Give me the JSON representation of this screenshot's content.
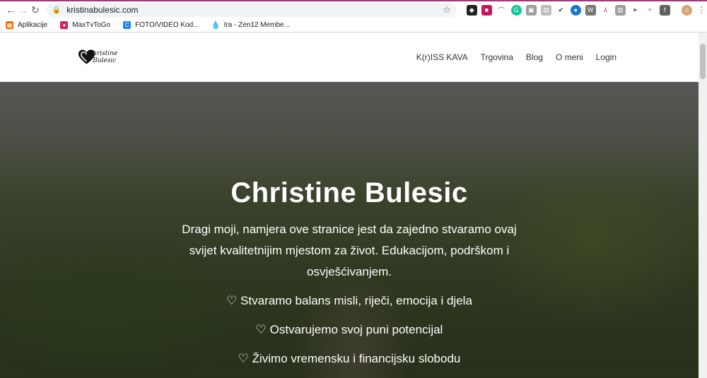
{
  "browser": {
    "url": "kristinabulesic.com",
    "bookmarks": [
      {
        "label": "Aplikacije",
        "icon": "apps-grid-icon",
        "color": "#e8710a"
      },
      {
        "label": "MaxTvToGo",
        "icon": "maxtv-icon",
        "color": "#d81b60"
      },
      {
        "label": "FOTO/VIDEO Kod...",
        "icon": "foto-icon",
        "color": "#1e88e5"
      },
      {
        "label": "Ira - Zen12 Membe...",
        "icon": "drop-icon",
        "color": "#039be5"
      }
    ]
  },
  "site": {
    "logo_text": "hristine Bulesic",
    "menu": [
      "K(r)ISS KAVA",
      "Trgovina",
      "Blog",
      "O meni",
      "Login"
    ]
  },
  "hero": {
    "title": "Christine Bulesic",
    "intro": "Dragi moji, namjera ove stranice jest da  zajedno stvaramo ovaj svijet kvalitetnijim mjestom za život. Edukacijom, podrškom i osvješćivanjem.",
    "lines": [
      "♡ Stvaramo balans misli, riječi, emocija i djela",
      "♡ Ostvarujemo svoj puni potencijal",
      "♡ Živimo vremensku i financijsku slobodu"
    ]
  }
}
